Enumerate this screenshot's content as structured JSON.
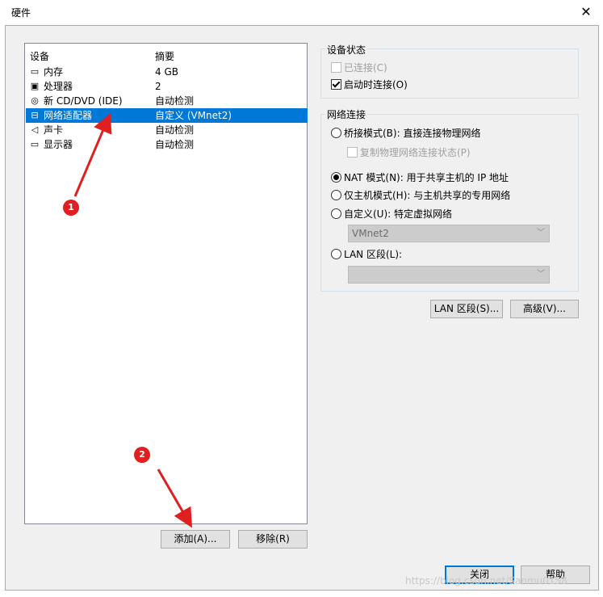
{
  "window": {
    "title": "硬件",
    "close_symbol": "✕"
  },
  "device_list": {
    "col_device": "设备",
    "col_summary": "摘要",
    "rows": [
      {
        "name": "内存",
        "summary": "4 GB",
        "icon": "memory-icon"
      },
      {
        "name": "处理器",
        "summary": "2",
        "icon": "cpu-icon"
      },
      {
        "name": "新 CD/DVD (IDE)",
        "summary": "自动检测",
        "icon": "cd-icon"
      },
      {
        "name": "网络适配器",
        "summary": "自定义 (VMnet2)",
        "icon": "network-adapter-icon",
        "selected": true
      },
      {
        "name": "声卡",
        "summary": "自动检测",
        "icon": "sound-icon"
      },
      {
        "name": "显示器",
        "summary": "自动检测",
        "icon": "monitor-icon"
      }
    ]
  },
  "device_status": {
    "label": "设备状态",
    "connected": "已连接(C)",
    "connect_at_power_on": "启动时连接(O)"
  },
  "network_connection": {
    "label": "网络连接",
    "bridged": "桥接模式(B): 直接连接物理网络",
    "replicate": "复制物理网络连接状态(P)",
    "nat": "NAT 模式(N): 用于共享主机的 IP 地址",
    "host_only": "仅主机模式(H): 与主机共享的专用网络",
    "custom": "自定义(U): 特定虚拟网络",
    "custom_value": "VMnet2",
    "lan_segment": "LAN 区段(L):",
    "lan_value": ""
  },
  "buttons": {
    "lan_segments": "LAN 区段(S)...",
    "advanced": "高级(V)...",
    "add": "添加(A)...",
    "remove": "移除(R)",
    "close": "关闭",
    "help": "帮助"
  },
  "annotations": {
    "badge1": "1",
    "badge2": "2"
  },
  "watermark": "https://blog.csdn.net/Sanmu0158",
  "colors": {
    "selection": "#0078d7",
    "annotation": "#e02020"
  }
}
